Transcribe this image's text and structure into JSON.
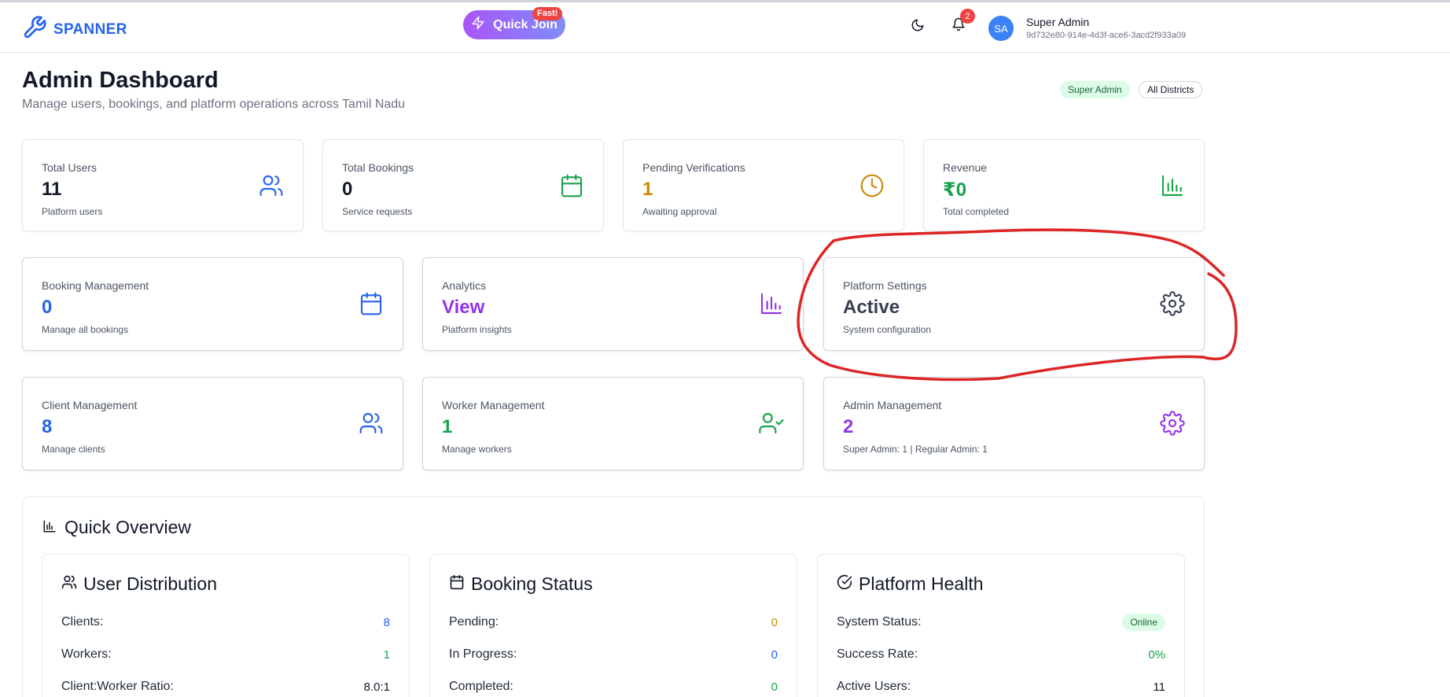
{
  "app": {
    "name": "SPANNER"
  },
  "header": {
    "quick_join": "Quick Join",
    "fast_badge": "Fast!",
    "notification_count": "2",
    "avatar_initials": "SA",
    "user_name": "Super Admin",
    "user_id": "9d732e80-914e-4d3f-ace6-3acd2f933a09"
  },
  "page": {
    "title": "Admin Dashboard",
    "subtitle": "Manage users, bookings, and platform operations across Tamil Nadu",
    "role_badge": "Super Admin",
    "district_badge": "All Districts"
  },
  "stats": [
    {
      "label": "Total Users",
      "value": "11",
      "desc": "Platform users",
      "icon": "users-icon",
      "color": "#111827",
      "icon_color": "#2563eb"
    },
    {
      "label": "Total Bookings",
      "value": "0",
      "desc": "Service requests",
      "icon": "calendar-icon",
      "color": "#111827",
      "icon_color": "#16a34a"
    },
    {
      "label": "Pending Verifications",
      "value": "1",
      "desc": "Awaiting approval",
      "icon": "clock-icon",
      "color": "#ca8a04",
      "icon_color": "#ca8a04"
    },
    {
      "label": "Revenue",
      "value": "₹0",
      "desc": "Total completed",
      "icon": "bar-chart-icon",
      "color": "#16a34a",
      "icon_color": "#16a34a"
    }
  ],
  "modules": [
    {
      "label": "Booking Management",
      "value": "0",
      "desc": "Manage all bookings",
      "icon": "calendar-icon",
      "color": "#2563eb",
      "icon_color": "#2563eb"
    },
    {
      "label": "Analytics",
      "value": "View",
      "desc": "Platform insights",
      "icon": "bar-chart-icon",
      "color": "#9333ea",
      "icon_color": "#9333ea"
    },
    {
      "label": "Platform Settings",
      "value": "Active",
      "desc": "System configuration",
      "icon": "gear-icon",
      "color": "#374151",
      "icon_color": "#374151"
    },
    {
      "label": "Client Management",
      "value": "8",
      "desc": "Manage clients",
      "icon": "users-icon",
      "color": "#2563eb",
      "icon_color": "#2563eb"
    },
    {
      "label": "Worker Management",
      "value": "1",
      "desc": "Manage workers",
      "icon": "user-check-icon",
      "color": "#16a34a",
      "icon_color": "#16a34a"
    },
    {
      "label": "Admin Management",
      "value": "2",
      "desc": "Super Admin: 1 | Regular Admin: 1",
      "icon": "gear-icon",
      "color": "#9333ea",
      "icon_color": "#9333ea"
    }
  ],
  "overview": {
    "title": "Quick Overview",
    "user_distribution": {
      "title": "User Distribution",
      "rows": [
        {
          "label": "Clients:",
          "value": "8",
          "color": "#2563eb"
        },
        {
          "label": "Workers:",
          "value": "1",
          "color": "#16a34a"
        },
        {
          "label": "Client:Worker Ratio:",
          "value": "8.0:1",
          "color": "#111827"
        }
      ]
    },
    "booking_status": {
      "title": "Booking Status",
      "rows": [
        {
          "label": "Pending:",
          "value": "0",
          "color": "#ca8a04"
        },
        {
          "label": "In Progress:",
          "value": "0",
          "color": "#2563eb"
        },
        {
          "label": "Completed:",
          "value": "0",
          "color": "#16a34a"
        }
      ]
    },
    "platform_health": {
      "title": "Platform Health",
      "rows": [
        {
          "label": "System Status:",
          "value": "Online",
          "color": "#166534"
        },
        {
          "label": "Success Rate:",
          "value": "0%",
          "color": "#16a34a"
        },
        {
          "label": "Active Users:",
          "value": "11",
          "color": "#111827"
        }
      ]
    }
  },
  "annotation_color": "#dc2626"
}
